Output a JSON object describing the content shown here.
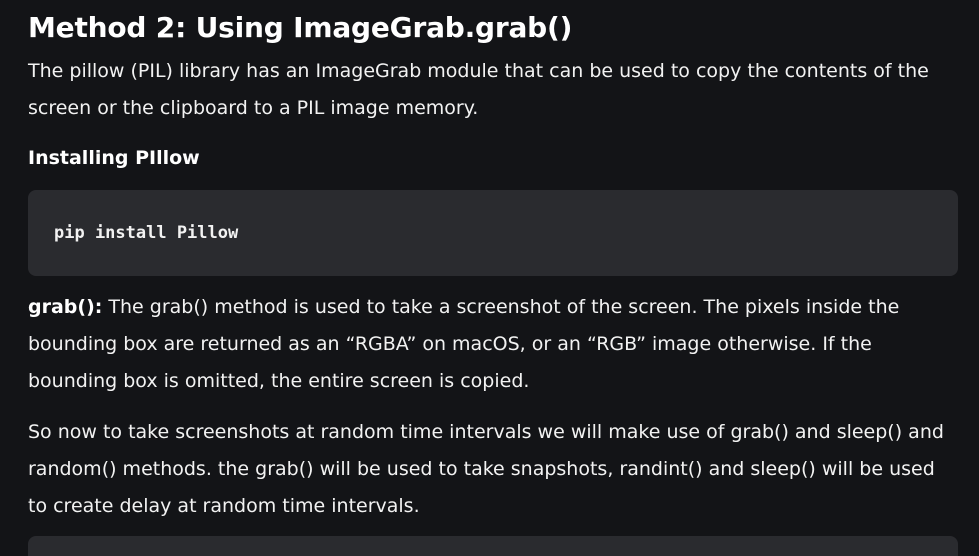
{
  "article": {
    "heading": "Method 2: Using ImageGrab.grab()",
    "intro": "The pillow (PIL) library has an ImageGrab module that can be used to copy the contents of the screen or the clipboard to a PIL image memory.",
    "subheading": "Installing PIllow",
    "code": "pip install Pillow",
    "grab_term": "grab():",
    "grab_desc": " The grab() method is used to take a screenshot of the screen. The pixels inside the bounding box are returned as an “RGBA” on macOS, or an “RGB” image otherwise. If the bounding box is omitted, the entire screen is copied.",
    "closing": "So now to take screenshots at random time intervals we will make use of grab() and sleep() and random() methods. the grab() will be used to take snapshots, randint() and sleep() will be used to create delay at random time intervals."
  },
  "colors": {
    "background": "#131417",
    "code_background": "#2a2b2f",
    "text": "#f2f2f2"
  }
}
